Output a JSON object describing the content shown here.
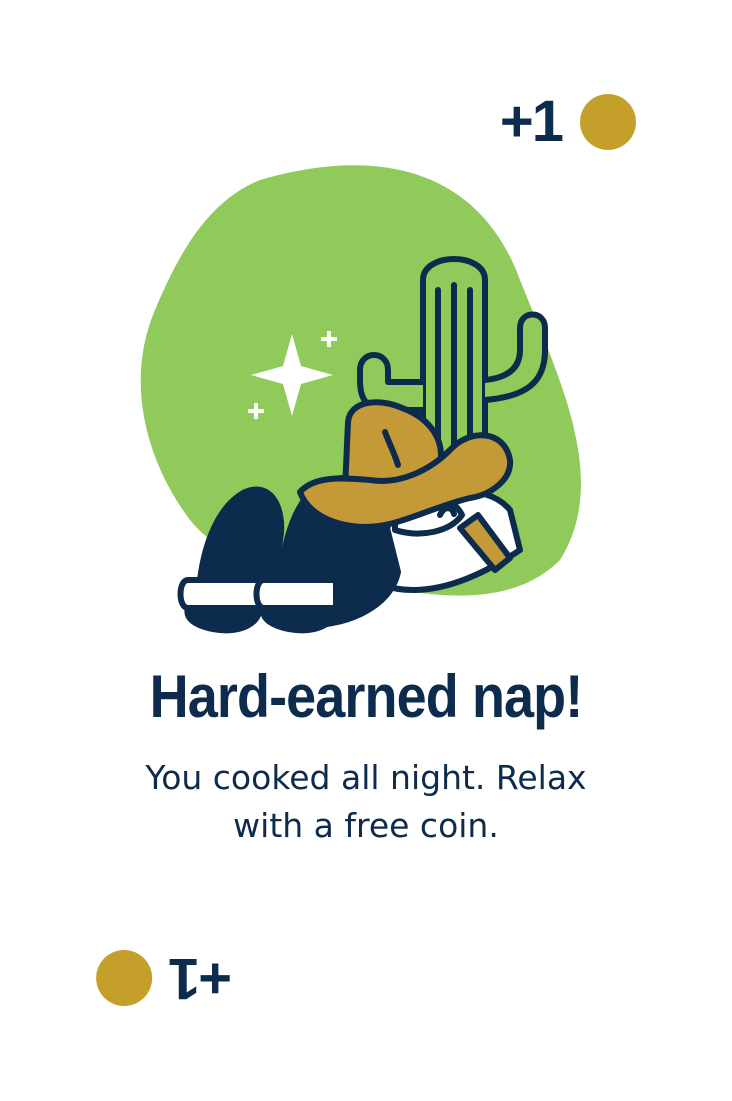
{
  "reward": {
    "amount_label": "+1",
    "coin_color": "#c4a02a"
  },
  "illustration": {
    "subject": "napping-cowboy-with-cactus",
    "blob_color": "#8fca5b",
    "ink_color": "#0d2b4c",
    "hat_color": "#c49a38"
  },
  "title": "Hard-earned nap!",
  "message": "You cooked all night. Relax with a free coin."
}
